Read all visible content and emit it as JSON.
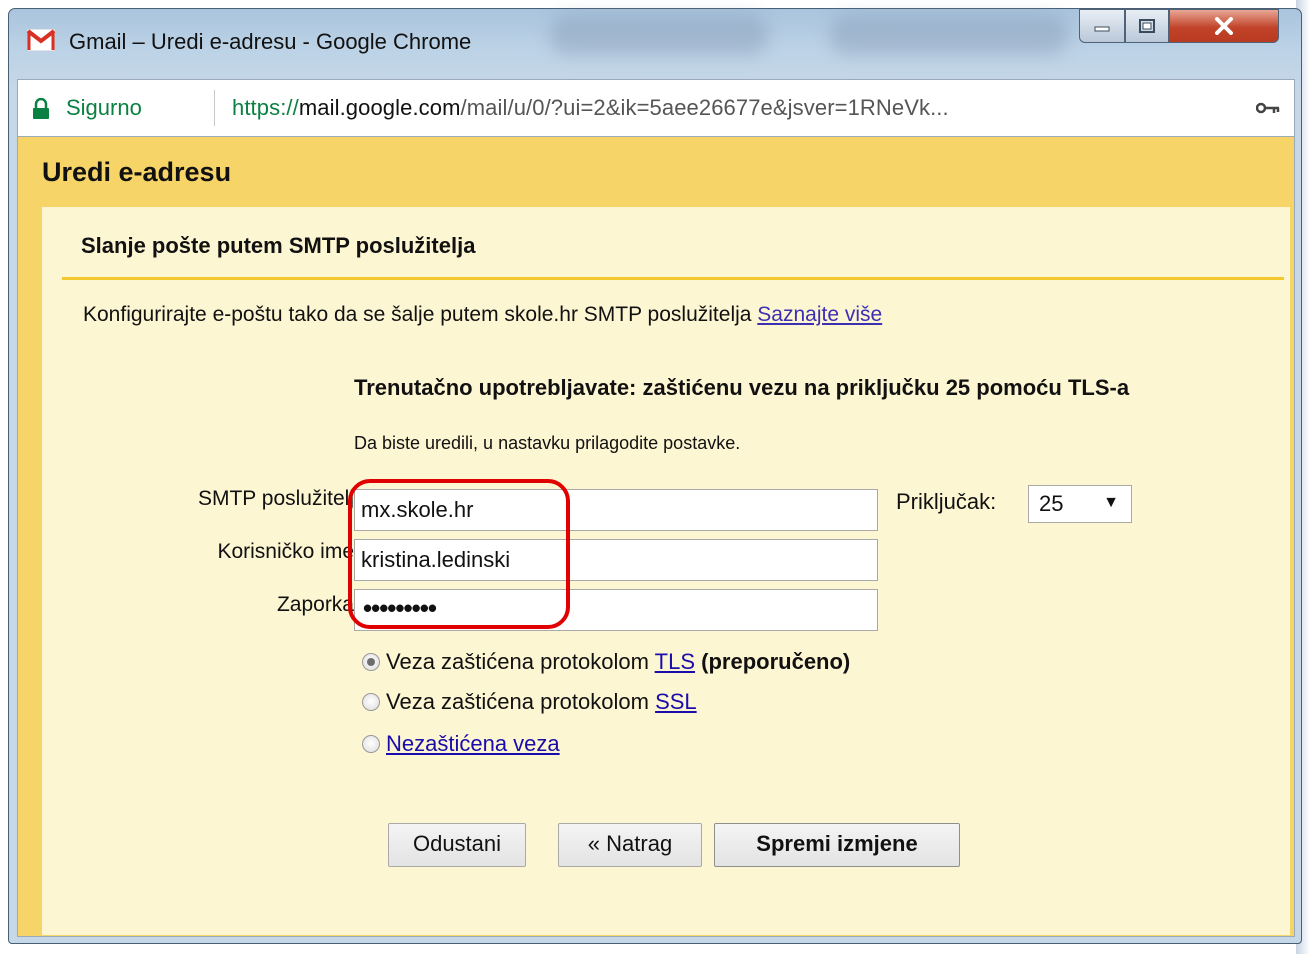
{
  "window": {
    "title": "Gmail – Uredi e-adresu - Google Chrome"
  },
  "address_bar": {
    "security_label": "Sigurno",
    "url_scheme": "https://",
    "url_host": "mail.google.com",
    "url_path": "/mail/u/0/?ui=2&ik=5aee26677e&jsver=1RNeVk..."
  },
  "dialog": {
    "title": "Uredi e-adresu",
    "section_title": "Slanje pošte putem SMTP poslužitelja",
    "intro_text": "Konfigurirajte e-poštu tako da se šalje putem skole.hr SMTP poslužitelja",
    "learn_more": "Saznajte više",
    "status_line": "Trenutačno upotrebljavate: zaštićenu vezu na priključku 25 pomoću TLS-a",
    "status_hint": "Da biste uredili, u nastavku prilagodite postavke.",
    "smtp_label": "SMTP poslužitelj",
    "smtp_value": "mx.skole.hr",
    "port_label": "Priključak:",
    "port_value": "25",
    "username_label": "Korisničko ime",
    "username_value": "kristina.ledinski",
    "password_label": "Zaporka",
    "password_mask": "•••••••••",
    "options": [
      {
        "prefix": "Veza zaštićena protokolom",
        "link": "TLS",
        "suffix": "(preporučeno)",
        "checked": true
      },
      {
        "prefix": "Veza zaštićena protokolom",
        "link": "SSL",
        "suffix": "",
        "checked": false
      },
      {
        "prefix": "",
        "link": "Nezaštićena veza",
        "suffix": "",
        "checked": false
      }
    ],
    "buttons": {
      "cancel": "Odustani",
      "back": "« Natrag",
      "save": "Spremi izmjene"
    }
  },
  "colors": {
    "dialog_header": "#f6d467",
    "panel_bg": "#fdf6d3",
    "rule": "#f3c72d",
    "highlight": "#e00000",
    "secure_green": "#0b8043"
  }
}
